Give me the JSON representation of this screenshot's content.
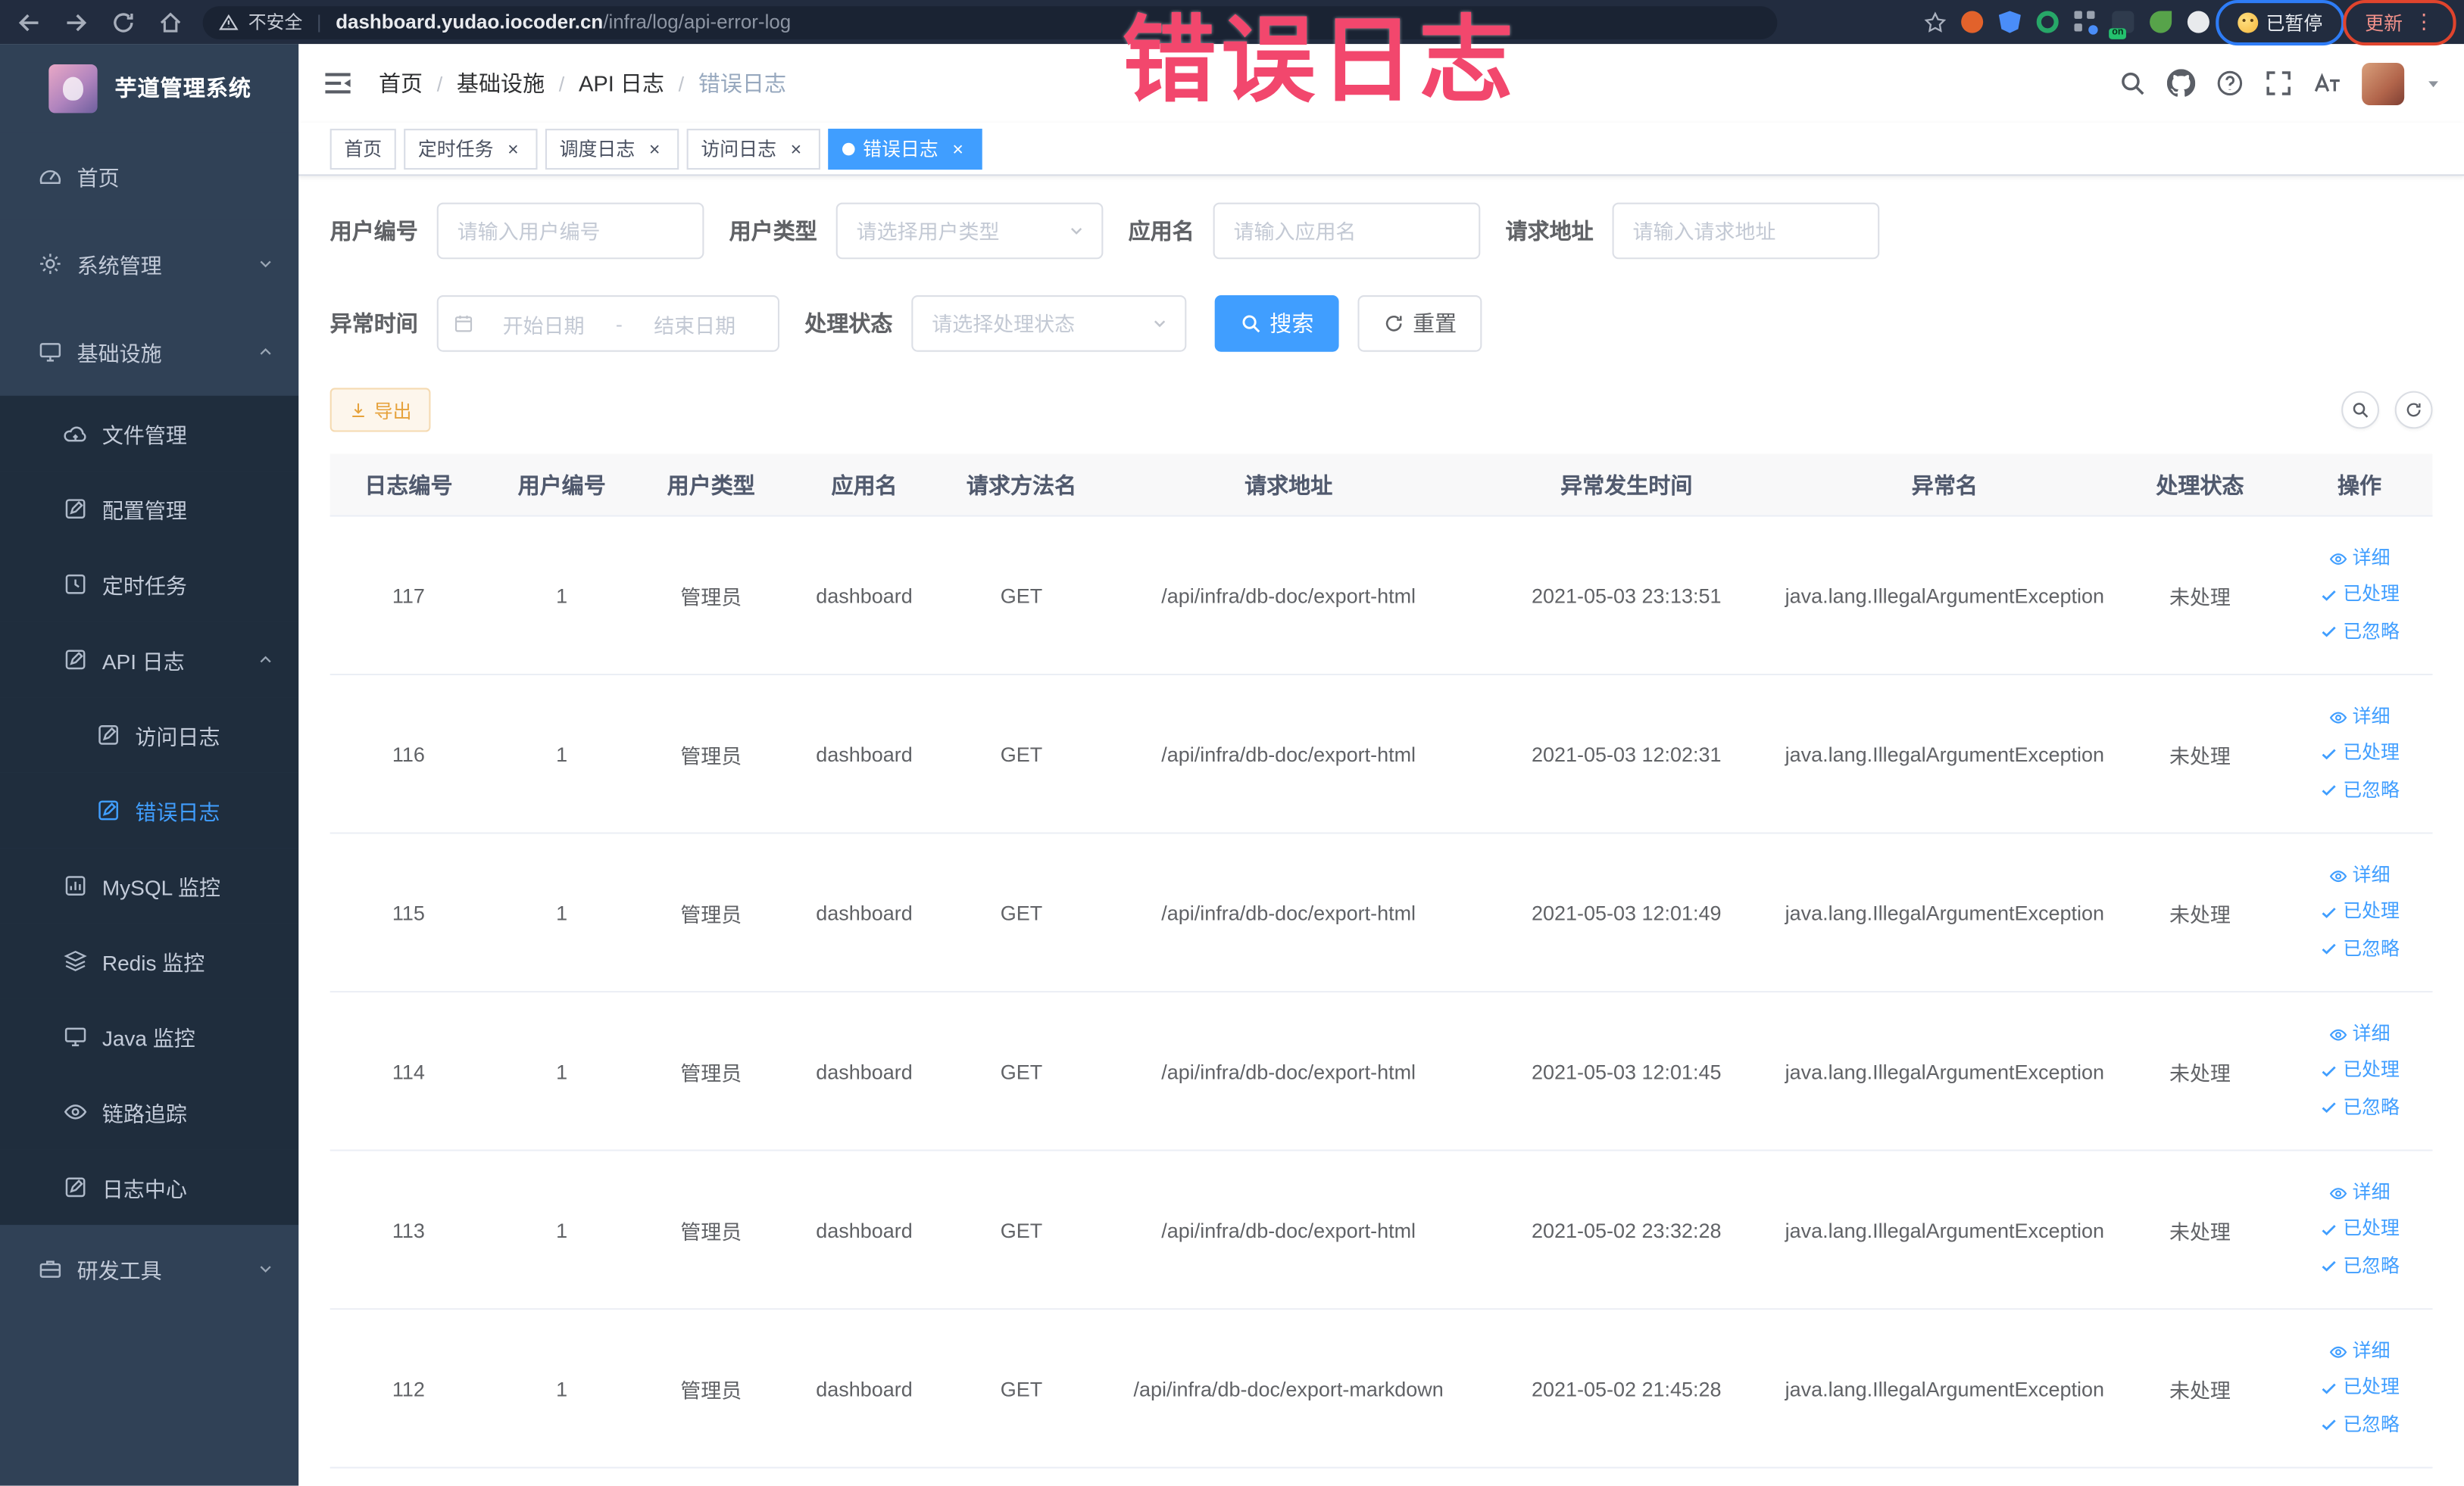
{
  "theme": {
    "accent": "#409eff",
    "sidebar_bg": "#304156",
    "submenu_bg": "#1f2d3d",
    "active_tab_bg": "#409eff",
    "warning_btn": {
      "bg": "#fdf6ec",
      "border": "#f5dab1",
      "text": "#e6a23c"
    },
    "annotation_color": "#f2476d"
  },
  "annotation": {
    "text": "错误日志"
  },
  "browser": {
    "security_label": "不安全",
    "url_host": "dashboard.yudao.iocoder.cn",
    "url_path": "/infra/log/api-error-log",
    "extensions": [
      {
        "name": "extension-orange-icon",
        "color": "#e2622b",
        "shape": "circle"
      },
      {
        "name": "extension-shield-icon",
        "color": "#4a8df8",
        "shape": "shield"
      },
      {
        "name": "extension-green-check-icon",
        "color": "#27a768",
        "shape": "ring"
      },
      {
        "name": "extension-grid-icon",
        "color": "#9aa2af",
        "shape": "grid"
      },
      {
        "name": "extension-on-switch-icon",
        "color": "#2f3b4d",
        "shape": "square",
        "label": "on"
      },
      {
        "name": "extension-leaf-icon",
        "color": "#57a34a",
        "shape": "leaf"
      },
      {
        "name": "extension-pin-icon",
        "color": "#e8eaed",
        "shape": "circle"
      }
    ],
    "paused_chip": {
      "label": "已暂停",
      "ellipse_color": "#2e7cf6"
    },
    "update_chip": {
      "label": "更新",
      "menu_glyph": "⋮",
      "ellipse_color": "#e0442d"
    }
  },
  "sidebar": {
    "logo_title": "芋道管理系统",
    "menu": [
      {
        "key": "home",
        "label": "首页",
        "icon": "dashboard",
        "level": 1
      },
      {
        "key": "system",
        "label": "系统管理",
        "icon": "gear",
        "level": 1,
        "arrow": "down"
      },
      {
        "key": "infra",
        "label": "基础设施",
        "icon": "monitor",
        "level": 1,
        "arrow": "up"
      },
      {
        "key": "file",
        "label": "文件管理",
        "icon": "cloud",
        "level": 2
      },
      {
        "key": "config",
        "label": "配置管理",
        "icon": "edit",
        "level": 2
      },
      {
        "key": "job",
        "label": "定时任务",
        "icon": "clock",
        "level": 2
      },
      {
        "key": "api-log",
        "label": "API 日志",
        "icon": "edit",
        "level": 2,
        "arrow": "up"
      },
      {
        "key": "access-log",
        "label": "访问日志",
        "icon": "edit",
        "level": 3
      },
      {
        "key": "error-log",
        "label": "错误日志",
        "icon": "edit",
        "level": 3,
        "active": true
      },
      {
        "key": "mysql",
        "label": "MySQL 监控",
        "icon": "chart",
        "level": 2
      },
      {
        "key": "redis",
        "label": "Redis 监控",
        "icon": "layers",
        "level": 2
      },
      {
        "key": "java",
        "label": "Java 监控",
        "icon": "monitor",
        "level": 2
      },
      {
        "key": "trace",
        "label": "链路追踪",
        "icon": "eye",
        "level": 2
      },
      {
        "key": "log-center",
        "label": "日志中心",
        "icon": "edit",
        "level": 2
      },
      {
        "key": "dev-tools",
        "label": "研发工具",
        "icon": "tool",
        "level": 1,
        "arrow": "down"
      }
    ]
  },
  "header": {
    "breadcrumb": [
      "首页",
      "基础设施",
      "API 日志",
      "错误日志"
    ]
  },
  "tabs": [
    {
      "key": "home",
      "label": "首页",
      "closable": false,
      "active": false
    },
    {
      "key": "job",
      "label": "定时任务",
      "closable": true,
      "active": false
    },
    {
      "key": "job-log",
      "label": "调度日志",
      "closable": true,
      "active": false
    },
    {
      "key": "access-log",
      "label": "访问日志",
      "closable": true,
      "active": false
    },
    {
      "key": "error-log",
      "label": "错误日志",
      "closable": true,
      "active": true
    }
  ],
  "filters": {
    "items": [
      {
        "label": "用户编号",
        "placeholder": "请输入用户编号",
        "type": "input"
      },
      {
        "label": "用户类型",
        "placeholder": "请选择用户类型",
        "type": "select"
      },
      {
        "label": "应用名",
        "placeholder": "请输入应用名",
        "type": "input"
      },
      {
        "label": "请求地址",
        "placeholder": "请输入请求地址",
        "type": "input"
      }
    ],
    "time_label": "异常时间",
    "date_start_placeholder": "开始日期",
    "date_separator": "-",
    "date_end_placeholder": "结束日期",
    "status_label": "处理状态",
    "status_placeholder": "请选择处理状态",
    "search_label": "搜索",
    "reset_label": "重置"
  },
  "toolbar": {
    "export_label": "导出"
  },
  "table": {
    "columns": [
      "日志编号",
      "用户编号",
      "用户类型",
      "应用名",
      "请求方法名",
      "请求地址",
      "异常发生时间",
      "异常名",
      "处理状态",
      "操作"
    ],
    "row_actions": [
      {
        "key": "detail",
        "label": "详细",
        "icon": "eye"
      },
      {
        "key": "processed",
        "label": "已处理",
        "icon": "check"
      },
      {
        "key": "ignored",
        "label": "已忽略",
        "icon": "check"
      }
    ],
    "rows": [
      {
        "id": "117",
        "user_id": "1",
        "user_type": "管理员",
        "app": "dashboard",
        "method": "GET",
        "url": "/api/infra/db-doc/export-html",
        "time": "2021-05-03 23:13:51",
        "exception": "java.lang.IllegalArgumentException",
        "status": "未处理"
      },
      {
        "id": "116",
        "user_id": "1",
        "user_type": "管理员",
        "app": "dashboard",
        "method": "GET",
        "url": "/api/infra/db-doc/export-html",
        "time": "2021-05-03 12:02:31",
        "exception": "java.lang.IllegalArgumentException",
        "status": "未处理"
      },
      {
        "id": "115",
        "user_id": "1",
        "user_type": "管理员",
        "app": "dashboard",
        "method": "GET",
        "url": "/api/infra/db-doc/export-html",
        "time": "2021-05-03 12:01:49",
        "exception": "java.lang.IllegalArgumentException",
        "status": "未处理"
      },
      {
        "id": "114",
        "user_id": "1",
        "user_type": "管理员",
        "app": "dashboard",
        "method": "GET",
        "url": "/api/infra/db-doc/export-html",
        "time": "2021-05-03 12:01:45",
        "exception": "java.lang.IllegalArgumentException",
        "status": "未处理"
      },
      {
        "id": "113",
        "user_id": "1",
        "user_type": "管理员",
        "app": "dashboard",
        "method": "GET",
        "url": "/api/infra/db-doc/export-html",
        "time": "2021-05-02 23:32:28",
        "exception": "java.lang.IllegalArgumentException",
        "status": "未处理"
      },
      {
        "id": "112",
        "user_id": "1",
        "user_type": "管理员",
        "app": "dashboard",
        "method": "GET",
        "url": "/api/infra/db-doc/export-markdown",
        "time": "2021-05-02 21:45:28",
        "exception": "java.lang.IllegalArgumentException",
        "status": "未处理"
      }
    ]
  }
}
